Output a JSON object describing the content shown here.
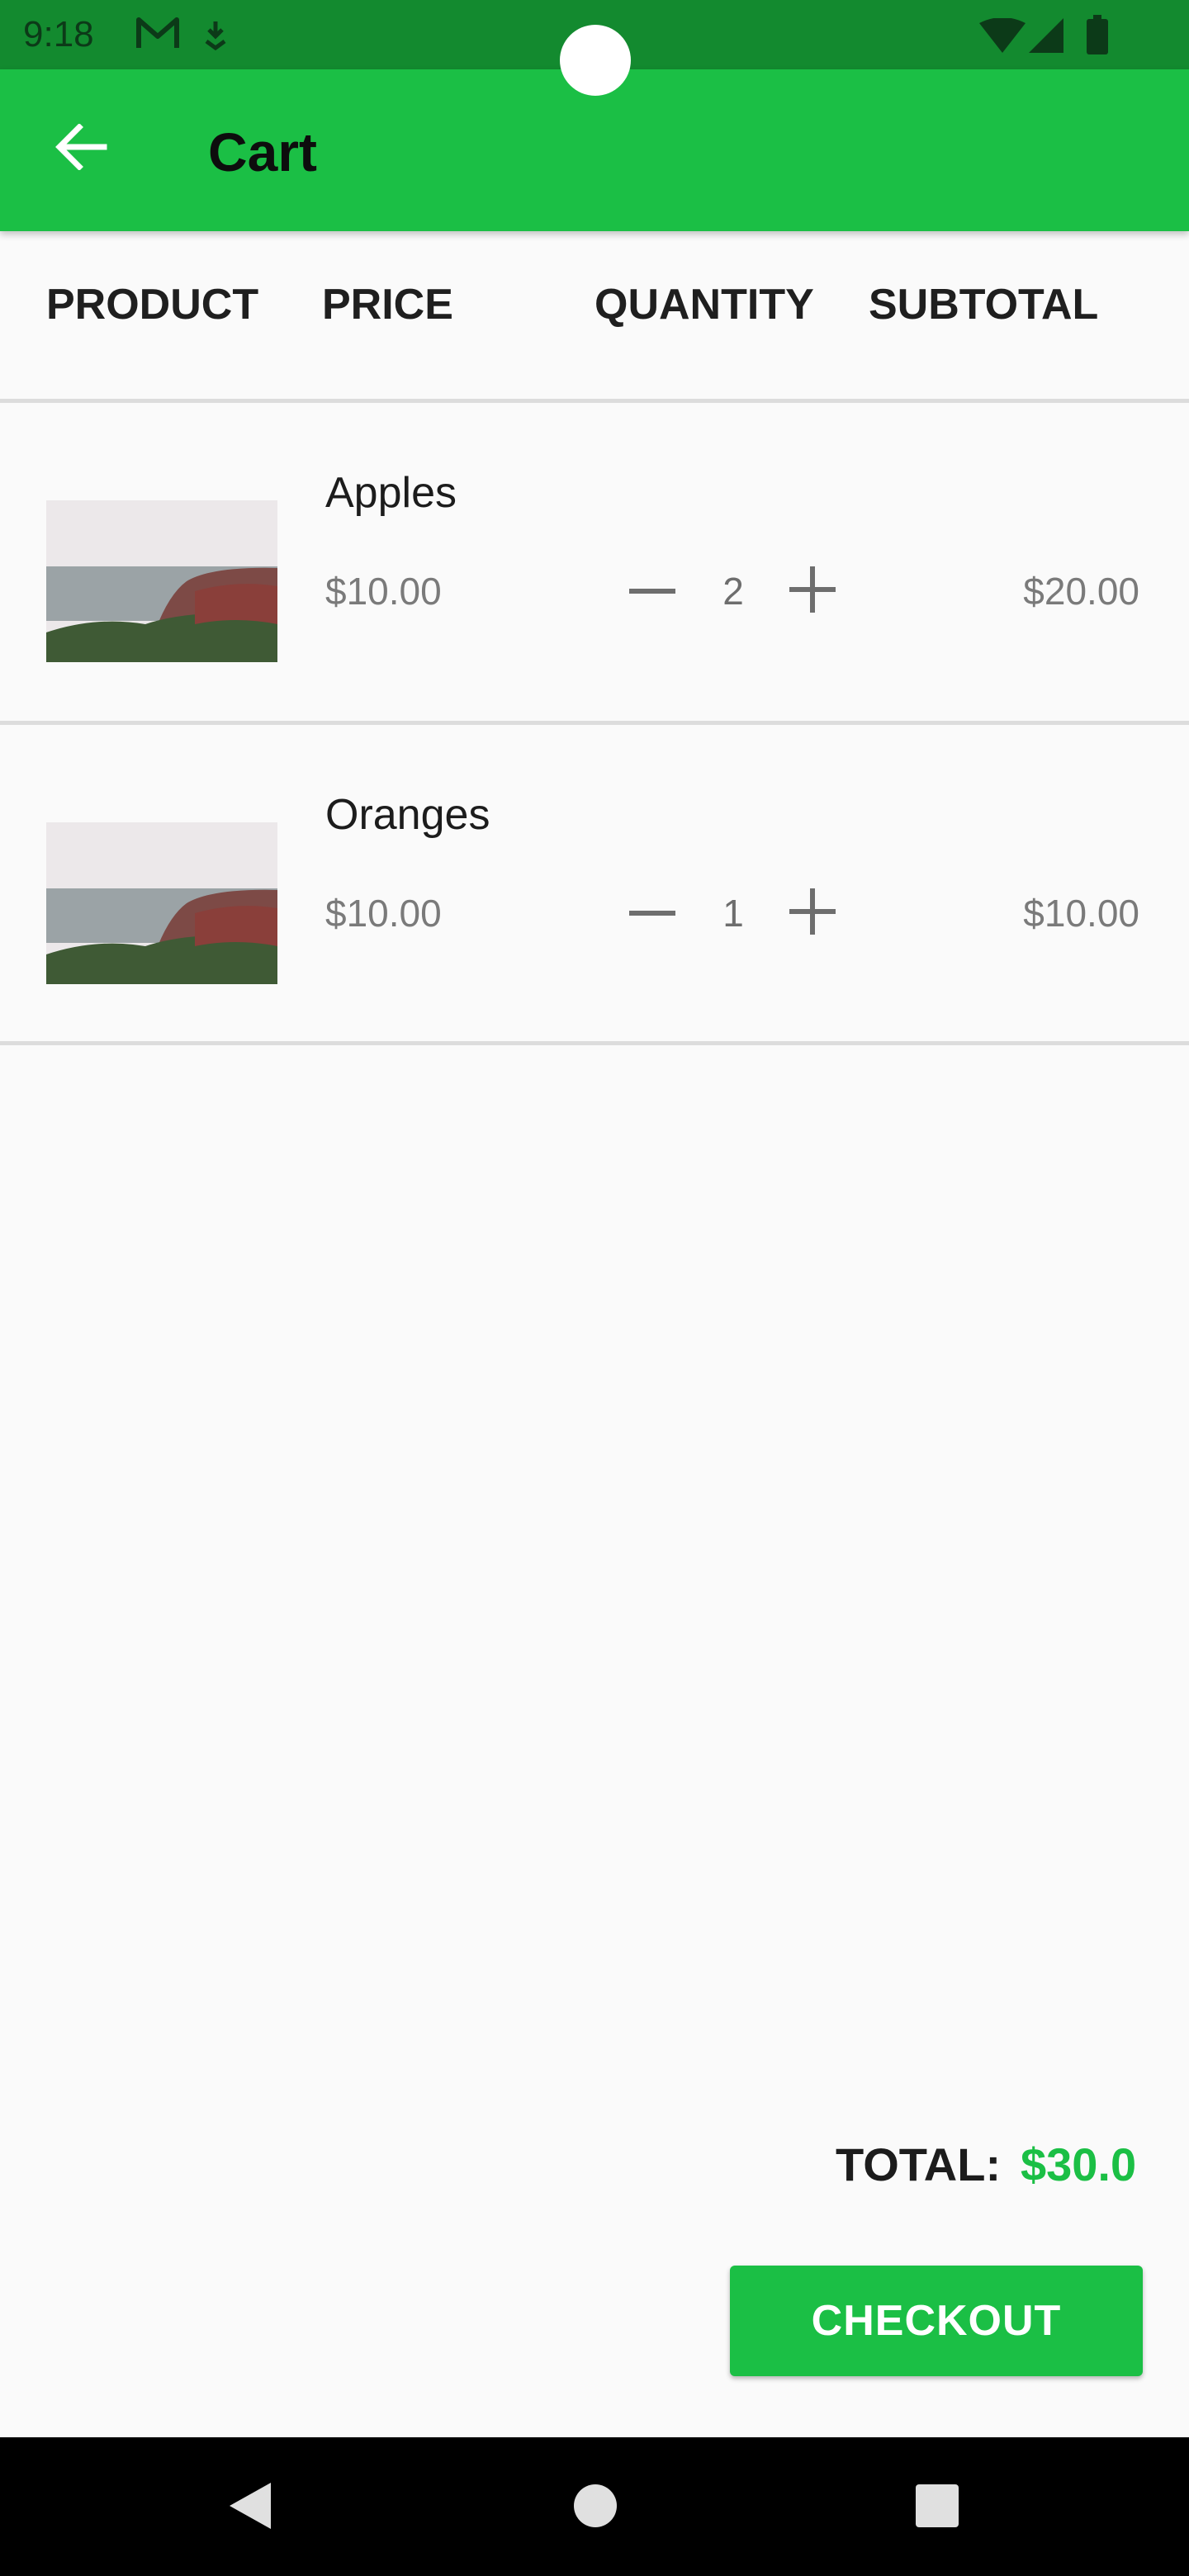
{
  "status_bar": {
    "time": "9:18",
    "left_icons": [
      "gmail-icon",
      "download-notification-icon"
    ],
    "right_icons": [
      "wifi-icon",
      "cell-signal-icon",
      "battery-icon"
    ]
  },
  "app_bar": {
    "title": "Cart",
    "back_icon": "arrow-back-icon",
    "color": "#1bbf45"
  },
  "columns": {
    "product": "PRODUCT",
    "price": "PRICE",
    "quantity": "QUANTITY",
    "subtotal": "SUBTOTAL"
  },
  "items": [
    {
      "name": "Apples",
      "price": "$10.00",
      "quantity": "2",
      "subtotal": "$20.00",
      "decrement_icon": "minus-icon",
      "increment_icon": "plus-icon",
      "thumbnail_icon": "product-thumbnail"
    },
    {
      "name": "Oranges",
      "price": "$10.00",
      "quantity": "1",
      "subtotal": "$10.00",
      "decrement_icon": "minus-icon",
      "increment_icon": "plus-icon",
      "thumbnail_icon": "product-thumbnail"
    }
  ],
  "footer": {
    "total_label": "TOTAL:",
    "total_value": "$30.0",
    "checkout_label": "CHECKOUT",
    "accent": "#1bbf45"
  },
  "nav_bar": {
    "icons": [
      "back-triangle-icon",
      "home-circle-icon",
      "recents-square-icon"
    ]
  }
}
